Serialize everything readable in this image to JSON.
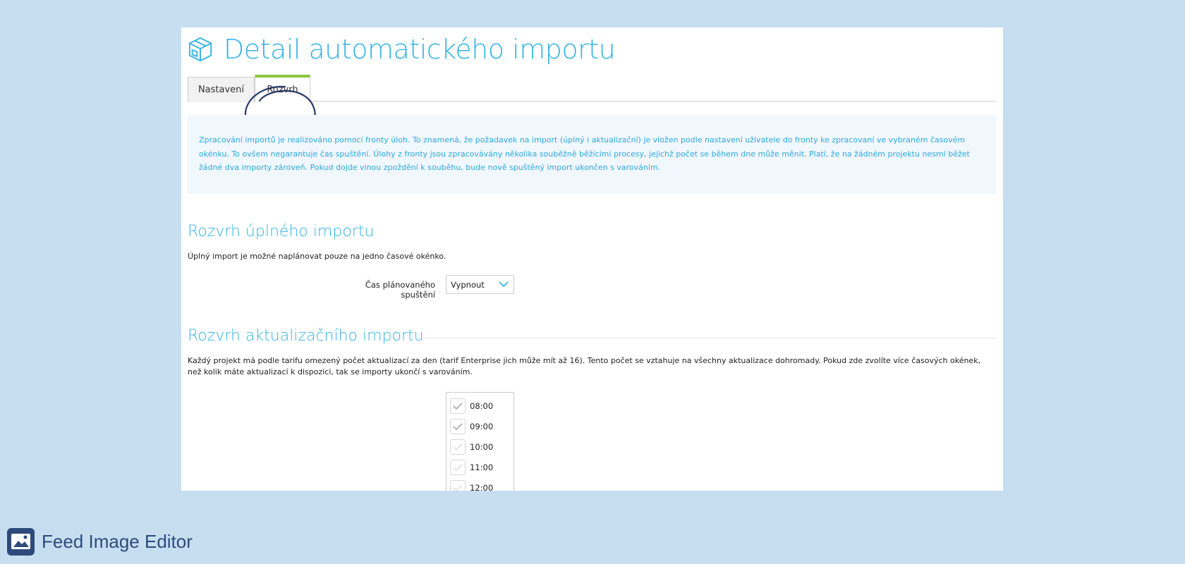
{
  "page": {
    "title": "Detail automatického importu",
    "title_icon": "box-icon"
  },
  "tabs": [
    {
      "label": "Nastavení",
      "active": false
    },
    {
      "label": "Rozvrh",
      "active": true
    }
  ],
  "info": {
    "text": "Zpracování importů je realizováno pomocí fronty úloh. To znamená, že požadavek na import (úplný i aktualizační) je vložen podle nastavení uživatele do fronty ke zpracovaní ve vybraném časovém okénku. To ovšem negarantuje čas spuštění. Úlohy z fronty jsou zpracovávány několika souběžně běžícími procesy, jejichž počet se během dne může měnit. Platí, že na žádném projektu nesmí běžet žádné dva importy zároveň. Pokud dojde vinou zpoždění k souběhu, bude nově spuštěný import ukončen s varováním."
  },
  "full_import": {
    "title": "Rozvrh úplného importu",
    "description": "Úplný import je možné naplánovat pouze na jedno časové okénko.",
    "time_label": "Čas plánovaného spuštění",
    "time_value": "Vypnout"
  },
  "update_import": {
    "title": "Rozvrh aktualizačního importu",
    "description": "Každý projekt má podle tarifu omezený počet aktualizací za den (tarif Enterprise jich může mít až 16). Tento počet se vztahuje na všechny aktualizace dohromady. Pokud zde zvolíte více časových okének, než kolik máte aktualizací k dispozici, tak se importy ukončí s varováním.",
    "times": [
      {
        "label": "08:00",
        "checked": true
      },
      {
        "label": "09:00",
        "checked": true
      },
      {
        "label": "10:00",
        "checked": false
      },
      {
        "label": "11:00",
        "checked": false
      },
      {
        "label": "12:00",
        "checked": false
      }
    ]
  },
  "footer": {
    "label": "Feed Image Editor",
    "icon": "image-icon"
  },
  "colors": {
    "background": "#c7def1",
    "accent": "#35b3e5",
    "tab_active": "#8cc63f",
    "footer_text": "#2e4a7a"
  }
}
